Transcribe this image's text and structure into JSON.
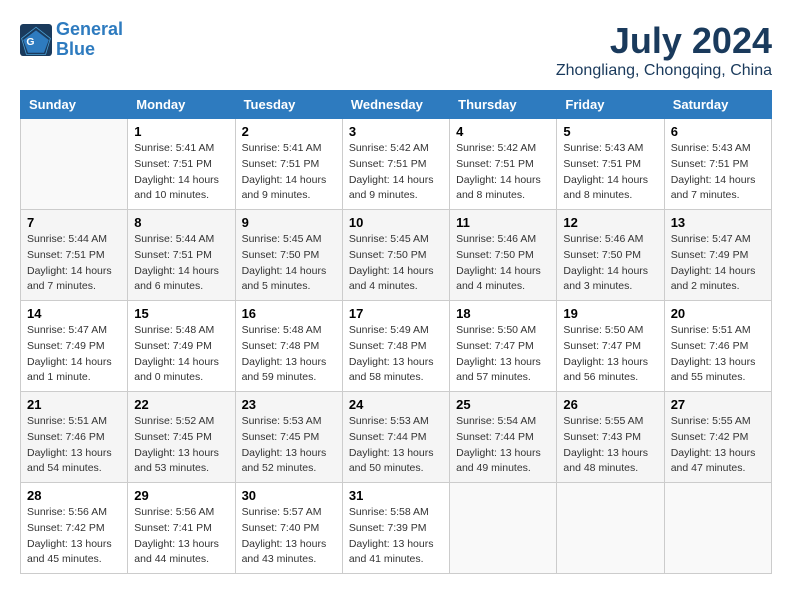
{
  "header": {
    "logo_line1": "General",
    "logo_line2": "Blue",
    "month": "July 2024",
    "location": "Zhongliang, Chongqing, China"
  },
  "weekdays": [
    "Sunday",
    "Monday",
    "Tuesday",
    "Wednesday",
    "Thursday",
    "Friday",
    "Saturday"
  ],
  "weeks": [
    [
      {
        "day": "",
        "info": ""
      },
      {
        "day": "1",
        "info": "Sunrise: 5:41 AM\nSunset: 7:51 PM\nDaylight: 14 hours\nand 10 minutes."
      },
      {
        "day": "2",
        "info": "Sunrise: 5:41 AM\nSunset: 7:51 PM\nDaylight: 14 hours\nand 9 minutes."
      },
      {
        "day": "3",
        "info": "Sunrise: 5:42 AM\nSunset: 7:51 PM\nDaylight: 14 hours\nand 9 minutes."
      },
      {
        "day": "4",
        "info": "Sunrise: 5:42 AM\nSunset: 7:51 PM\nDaylight: 14 hours\nand 8 minutes."
      },
      {
        "day": "5",
        "info": "Sunrise: 5:43 AM\nSunset: 7:51 PM\nDaylight: 14 hours\nand 8 minutes."
      },
      {
        "day": "6",
        "info": "Sunrise: 5:43 AM\nSunset: 7:51 PM\nDaylight: 14 hours\nand 7 minutes."
      }
    ],
    [
      {
        "day": "7",
        "info": "Sunrise: 5:44 AM\nSunset: 7:51 PM\nDaylight: 14 hours\nand 7 minutes."
      },
      {
        "day": "8",
        "info": "Sunrise: 5:44 AM\nSunset: 7:51 PM\nDaylight: 14 hours\nand 6 minutes."
      },
      {
        "day": "9",
        "info": "Sunrise: 5:45 AM\nSunset: 7:50 PM\nDaylight: 14 hours\nand 5 minutes."
      },
      {
        "day": "10",
        "info": "Sunrise: 5:45 AM\nSunset: 7:50 PM\nDaylight: 14 hours\nand 4 minutes."
      },
      {
        "day": "11",
        "info": "Sunrise: 5:46 AM\nSunset: 7:50 PM\nDaylight: 14 hours\nand 4 minutes."
      },
      {
        "day": "12",
        "info": "Sunrise: 5:46 AM\nSunset: 7:50 PM\nDaylight: 14 hours\nand 3 minutes."
      },
      {
        "day": "13",
        "info": "Sunrise: 5:47 AM\nSunset: 7:49 PM\nDaylight: 14 hours\nand 2 minutes."
      }
    ],
    [
      {
        "day": "14",
        "info": "Sunrise: 5:47 AM\nSunset: 7:49 PM\nDaylight: 14 hours\nand 1 minute."
      },
      {
        "day": "15",
        "info": "Sunrise: 5:48 AM\nSunset: 7:49 PM\nDaylight: 14 hours\nand 0 minutes."
      },
      {
        "day": "16",
        "info": "Sunrise: 5:48 AM\nSunset: 7:48 PM\nDaylight: 13 hours\nand 59 minutes."
      },
      {
        "day": "17",
        "info": "Sunrise: 5:49 AM\nSunset: 7:48 PM\nDaylight: 13 hours\nand 58 minutes."
      },
      {
        "day": "18",
        "info": "Sunrise: 5:50 AM\nSunset: 7:47 PM\nDaylight: 13 hours\nand 57 minutes."
      },
      {
        "day": "19",
        "info": "Sunrise: 5:50 AM\nSunset: 7:47 PM\nDaylight: 13 hours\nand 56 minutes."
      },
      {
        "day": "20",
        "info": "Sunrise: 5:51 AM\nSunset: 7:46 PM\nDaylight: 13 hours\nand 55 minutes."
      }
    ],
    [
      {
        "day": "21",
        "info": "Sunrise: 5:51 AM\nSunset: 7:46 PM\nDaylight: 13 hours\nand 54 minutes."
      },
      {
        "day": "22",
        "info": "Sunrise: 5:52 AM\nSunset: 7:45 PM\nDaylight: 13 hours\nand 53 minutes."
      },
      {
        "day": "23",
        "info": "Sunrise: 5:53 AM\nSunset: 7:45 PM\nDaylight: 13 hours\nand 52 minutes."
      },
      {
        "day": "24",
        "info": "Sunrise: 5:53 AM\nSunset: 7:44 PM\nDaylight: 13 hours\nand 50 minutes."
      },
      {
        "day": "25",
        "info": "Sunrise: 5:54 AM\nSunset: 7:44 PM\nDaylight: 13 hours\nand 49 minutes."
      },
      {
        "day": "26",
        "info": "Sunrise: 5:55 AM\nSunset: 7:43 PM\nDaylight: 13 hours\nand 48 minutes."
      },
      {
        "day": "27",
        "info": "Sunrise: 5:55 AM\nSunset: 7:42 PM\nDaylight: 13 hours\nand 47 minutes."
      }
    ],
    [
      {
        "day": "28",
        "info": "Sunrise: 5:56 AM\nSunset: 7:42 PM\nDaylight: 13 hours\nand 45 minutes."
      },
      {
        "day": "29",
        "info": "Sunrise: 5:56 AM\nSunset: 7:41 PM\nDaylight: 13 hours\nand 44 minutes."
      },
      {
        "day": "30",
        "info": "Sunrise: 5:57 AM\nSunset: 7:40 PM\nDaylight: 13 hours\nand 43 minutes."
      },
      {
        "day": "31",
        "info": "Sunrise: 5:58 AM\nSunset: 7:39 PM\nDaylight: 13 hours\nand 41 minutes."
      },
      {
        "day": "",
        "info": ""
      },
      {
        "day": "",
        "info": ""
      },
      {
        "day": "",
        "info": ""
      }
    ]
  ]
}
